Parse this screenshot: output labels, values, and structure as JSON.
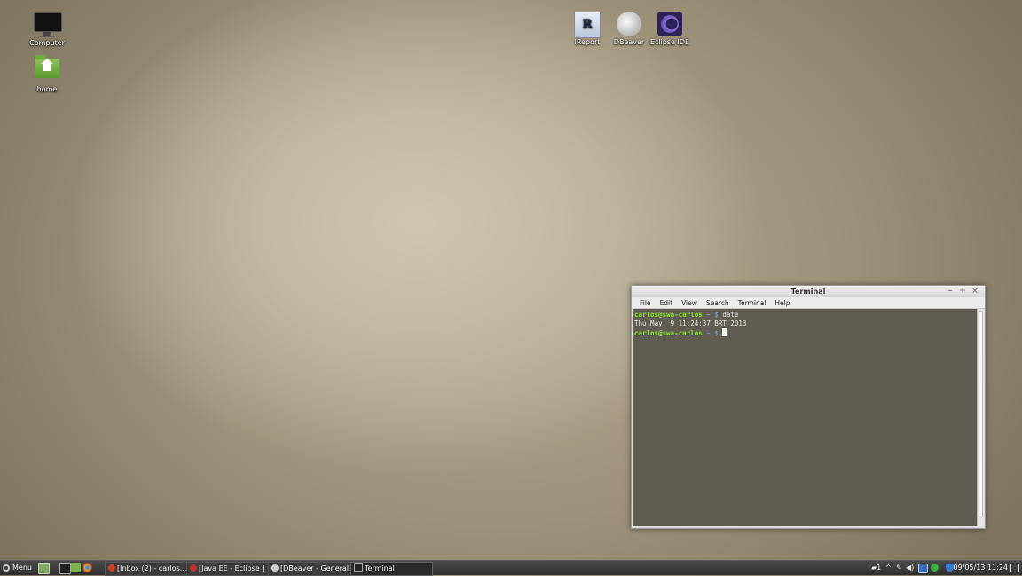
{
  "desktop": {
    "icons": [
      {
        "label": "Computer"
      },
      {
        "label": "home"
      },
      {
        "label": "iReport"
      },
      {
        "label": "DBeaver"
      },
      {
        "label": "Eclipse IDE"
      }
    ]
  },
  "terminal": {
    "title": "Terminal",
    "menu": [
      "File",
      "Edit",
      "View",
      "Search",
      "Terminal",
      "Help"
    ],
    "lines": [
      {
        "user": "carlos@swa-carlos",
        "path": "~ $",
        "command": "date"
      },
      {
        "output": "Thu May  9 11:24:37 BRT 2013"
      },
      {
        "user": "carlos@swa-carlos",
        "path": "~ $",
        "command": ""
      }
    ]
  },
  "taskbar": {
    "menu_label": "Menu",
    "tasks": [
      {
        "label": "[Inbox (2) - carlos...",
        "icon_color": "#d04020"
      },
      {
        "label": "[Java EE - Eclipse ]",
        "icon_color": "#c03030"
      },
      {
        "label": "[DBeaver - General...",
        "icon_color": "#cccccc"
      },
      {
        "label": "Terminal",
        "icon_color": "#222222"
      }
    ],
    "notification_count": "1",
    "clock": "09/05/13 11:24"
  }
}
